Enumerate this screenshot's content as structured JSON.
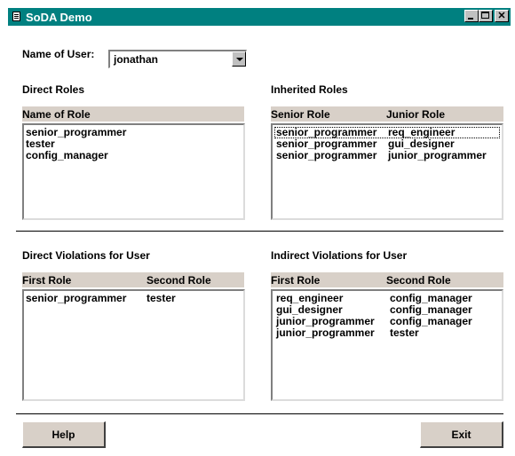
{
  "window": {
    "title": "SoDA Demo"
  },
  "user": {
    "label": "Name of User:",
    "value": "jonathan"
  },
  "direct_roles": {
    "heading": "Direct Roles",
    "column": "Name of Role",
    "items": [
      "senior_programmer",
      "tester",
      "config_manager"
    ]
  },
  "inherited_roles": {
    "heading": "Inherited Roles",
    "columns": [
      "Senior Role",
      "Junior Role"
    ],
    "rows": [
      [
        "senior_programmer",
        "req_engineer"
      ],
      [
        "senior_programmer",
        "gui_designer"
      ],
      [
        "senior_programmer",
        "junior_programmer"
      ]
    ]
  },
  "direct_violations": {
    "heading": "Direct Violations for User",
    "columns": [
      "First Role",
      "Second Role"
    ],
    "rows": [
      [
        "senior_programmer",
        "tester"
      ]
    ]
  },
  "indirect_violations": {
    "heading": "Indirect Violations for User",
    "columns": [
      "First Role",
      "Second Role"
    ],
    "rows": [
      [
        "req_engineer",
        "config_manager"
      ],
      [
        "gui_designer",
        "config_manager"
      ],
      [
        "junior_programmer",
        "config_manager"
      ],
      [
        "junior_programmer",
        "tester"
      ]
    ]
  },
  "buttons": {
    "help": "Help",
    "exit": "Exit"
  },
  "colors": {
    "titlebar": "#008080",
    "header": "#d8d0c8"
  }
}
